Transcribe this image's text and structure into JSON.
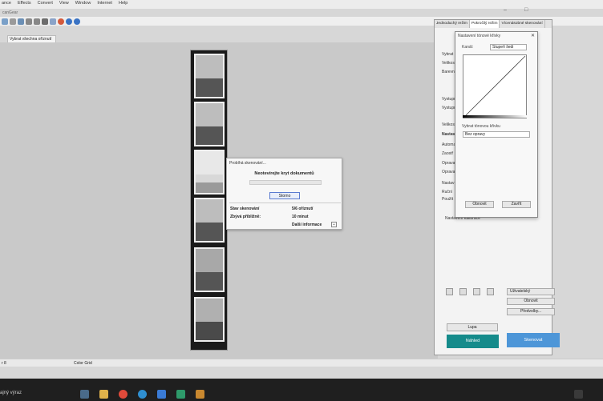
{
  "menu": [
    "ance",
    "Effects",
    "Convert",
    "View",
    "Window",
    "Internet",
    "Help"
  ],
  "app": {
    "title": "canGear"
  },
  "toolbar_tab": "Vybrat všechna oříznutí",
  "dialog": {
    "title": "Probíhá skenování...",
    "message": "Neotevírejte kryt dokumentů",
    "cancel": "Storno",
    "status_label": "Stav skenování",
    "status_value": "5/6 oříznutí",
    "remaining_label": "Zbývá přibližně:",
    "remaining_value": "10 minut",
    "more_info": "Další informace"
  },
  "panel": {
    "tabs": [
      "Jednoduchý režim",
      "Pokročilý režim",
      "Vícenásobné skenování"
    ],
    "labels": [
      "Vybrat",
      "Velikost",
      "Barevný",
      "Vystupní",
      "Vystupní",
      "Velikost",
      "Nastavení",
      "Automati",
      "Zaostř",
      "Oprava",
      "Oprava",
      "Nastav",
      "Ruční",
      "Použít",
      "Nastavení kalibrace"
    ],
    "user_defined": "Uživatelský",
    "refresh": "Obnovit",
    "presets": "Předvolby...",
    "loupe": "Lupa",
    "preview": "Náhled",
    "scan": "Skenovat"
  },
  "tone_curve": {
    "title": "Nastavení tónové křivky",
    "channel_label": "Kanál:",
    "channel_value": "Stupeň šedi",
    "pick_label": "Vybrat tónovou křivku",
    "pick_value": "Bez opravy",
    "refresh": "Obnovit",
    "close": "Zavřít"
  },
  "statusbar": {
    "left": "r 8",
    "mid": "Color Grid"
  },
  "taskbar": {
    "search": "ajný výraz"
  }
}
